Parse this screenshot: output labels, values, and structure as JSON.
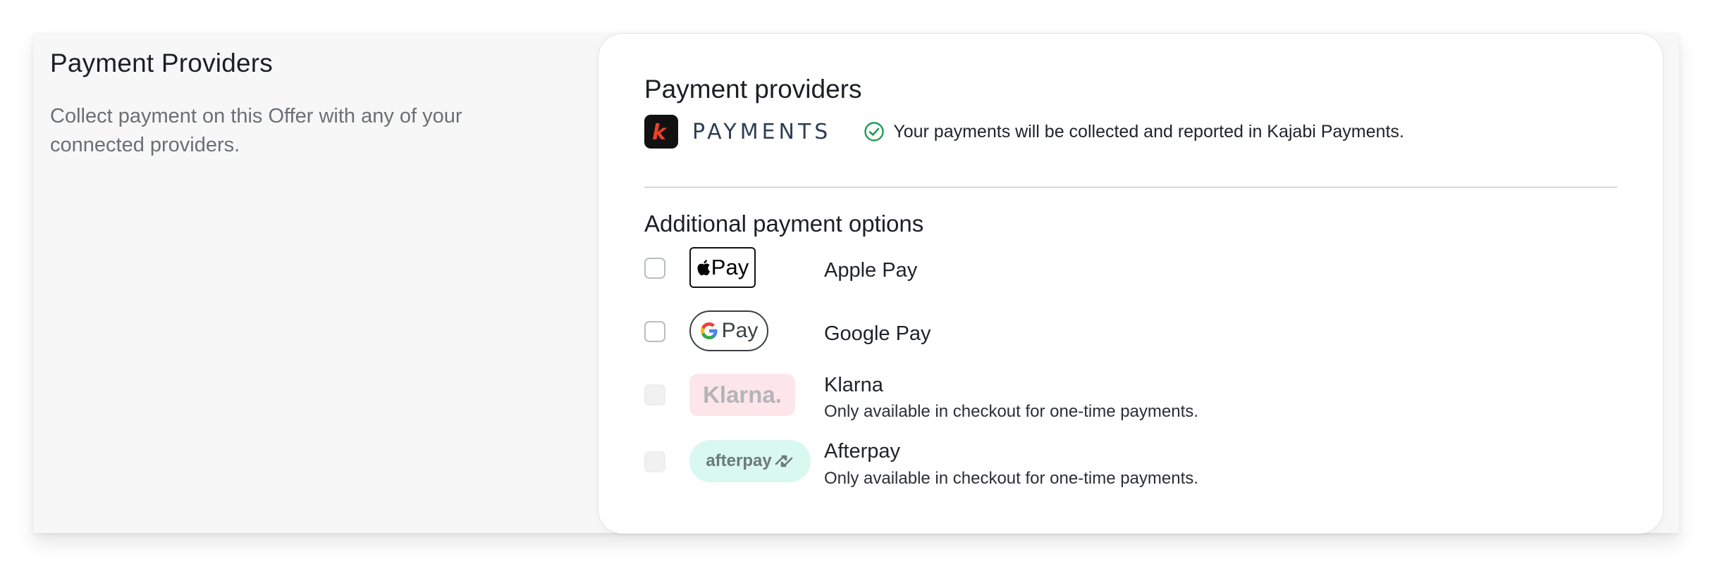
{
  "left": {
    "title": "Payment Providers",
    "description": "Collect payment on this Offer with any of your connected providers."
  },
  "card": {
    "title": "Payment providers",
    "kajabi": {
      "logo_letter": "k",
      "wordmark": "PAYMENTS",
      "status_message": "Your payments will be collected and reported in Kajabi Payments."
    },
    "additional_title": "Additional payment options",
    "options": [
      {
        "badge": "Pay",
        "label": "Apple Pay",
        "note": "",
        "checked": false,
        "disabled": false
      },
      {
        "badge": "Pay",
        "label": "Google Pay",
        "note": "",
        "checked": false,
        "disabled": false
      },
      {
        "badge": "Klarna.",
        "label": "Klarna",
        "note": "Only available in checkout for one-time payments.",
        "checked": false,
        "disabled": true
      },
      {
        "badge": "afterpay",
        "label": "Afterpay",
        "note": "Only available in checkout for one-time payments.",
        "checked": false,
        "disabled": true
      }
    ]
  },
  "colors": {
    "kajabi_accent": "#e8412c",
    "success_green": "#1f9d55",
    "klarna_pink": "#fde6ea",
    "afterpay_mint": "#d9f8ef"
  }
}
